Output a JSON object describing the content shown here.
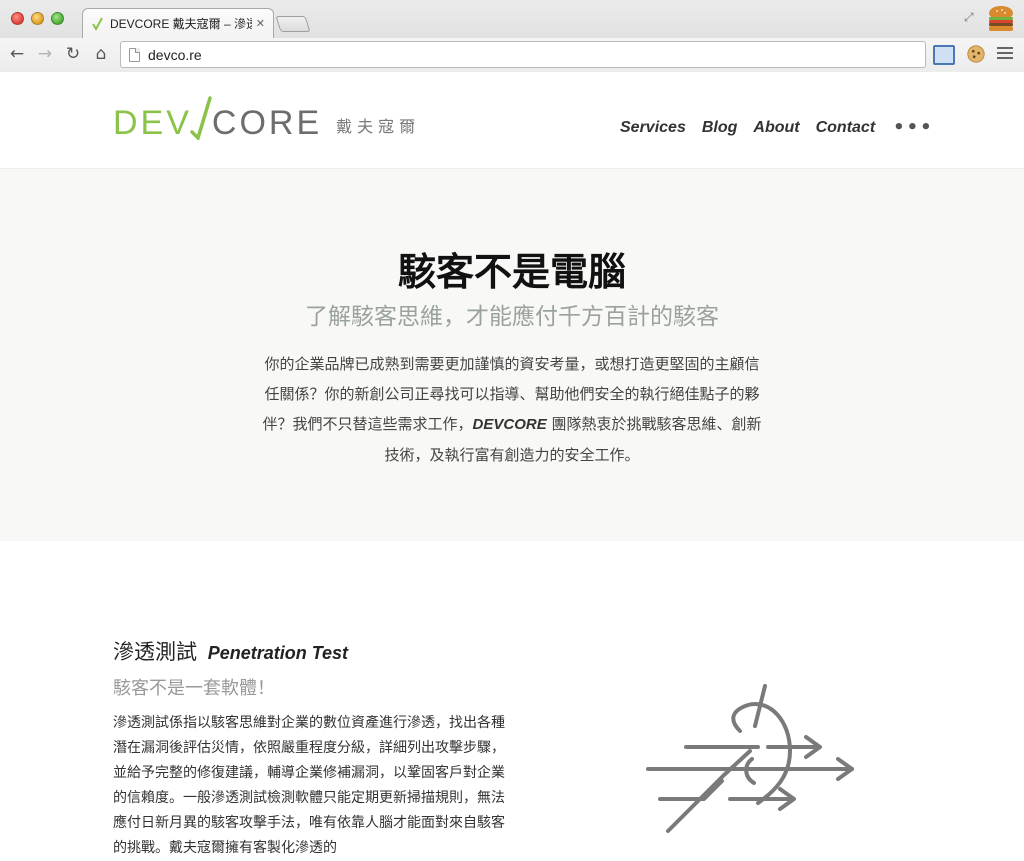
{
  "browser": {
    "tab_title": "DEVCORE 戴夫寇爾 – 滲透測",
    "tab_close": "✕",
    "url": "devco.re",
    "colors": {
      "chrome": "#e3e3e3",
      "favicon": "#8bc34a"
    }
  },
  "site": {
    "logo_dev": "DEV",
    "logo_core": "CORE",
    "logo_cn": "戴夫寇爾",
    "nav": [
      "Services",
      "Blog",
      "About",
      "Contact"
    ],
    "nav_more": "•••",
    "colors": {
      "brand_green": "#8bc34a",
      "brand_gray": "#6d6d6d",
      "hero_bg": "#f8f8f6"
    }
  },
  "hero": {
    "title": "駭客不是電腦",
    "subtitle": "了解駭客思維，才能應付千方百計的駭客",
    "paragraph_before": "你的企業品牌已成熟到需要更加謹慎的資安考量，或想打造更堅固的主顧信任關係？你的新創公司正尋找可以指導、幫助他們安全的執行絕佳點子的夥伴？我們不只替這些需求工作，",
    "paragraph_brand": "DEVCORE",
    "paragraph_after": " 團隊熱衷於挑戰駭客思維、創新技術，及執行富有創造力的安全工作。"
  },
  "service": {
    "title_cn": "滲透測試",
    "title_en": "Penetration Test",
    "subtitle": "駭客不是一套軟體！",
    "description": "滲透測試係指以駭客思維對企業的數位資產進行滲透，找出各種潛在漏洞後評估災情，依照嚴重程度分級，詳細列出攻擊步驟，並給予完整的修復建議，輔導企業修補漏洞，以鞏固客戶對企業的信賴度。一般滲透測試檢測軟體只能定期更新掃描規則，無法應付日新月異的駭客攻擊手法，唯有依靠人腦才能面對來自駭客的挑戰。戴夫寇爾擁有客製化滲透的",
    "illustration_icon": "penetration-arrows-icon"
  }
}
